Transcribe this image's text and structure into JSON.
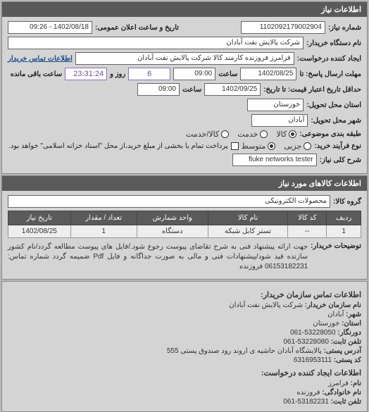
{
  "panel1": {
    "title": "اطلاعات نیاز",
    "request_no_label": "شماره نیاز:",
    "request_no": "1102092179002904",
    "public_datetime_label": "تاریخ و ساعت اعلان عمومی:",
    "public_datetime": "1402/08/18 - 09:26",
    "buyer_org_label": "نام دستگاه خریدار:",
    "buyer_org": "شرکت پالایش نفت آبادان",
    "requester_label": "ایجاد کننده درخواست:",
    "requester": "فرامرز فروزنده کارمند کالا شرکت پالایش نفت آبادان",
    "contact_link": "اطلاعات تماس خریدار",
    "deadline_label": "مهلت ارسال پاسخ: تا",
    "deadline_date": "1402/08/25",
    "time_label1": "ساعت",
    "deadline_time": "09:00",
    "and_label": "و",
    "days_remaining": "6",
    "days_label": "روز و",
    "time_remaining": "23:31:24",
    "remaining_label": "ساعت باقی مانده",
    "validity_label": "حداقل تاریخ اعتبار قیمت: تا تاریخ:",
    "validity_date": "1402/09/25",
    "time_label2": "ساعت",
    "validity_time": "09:00",
    "province_label": "استان محل تحویل:",
    "province": "خوزستان",
    "city_label": "شهر محل تحویل:",
    "city": "آبادان",
    "category_label": "طبقه بندی موضوعی:",
    "cat_goods": "کالا",
    "cat_service": "خدمت",
    "cat_goods_service": "کالا/خدمت",
    "process_label": "نوع فرآیند خرید:",
    "proc_small": "جزیی",
    "proc_medium": "متوسط",
    "payment_note": "پرداخت تمام یا بخشی از مبلغ خرید،از محل \"اسناد خزانه اسلامی\" خواهد بود.",
    "keyword_label": "شرح کلی نیاز:",
    "keyword": "fluke networks tester"
  },
  "panel2": {
    "title": "اطلاعات کالاهای مورد نیاز",
    "group_label": "گروه کالا:",
    "group": "محصولات الکترونیکی",
    "headers": {
      "row": "ردیف",
      "code": "کد کالا",
      "name": "نام کالا",
      "unit": "واحد شمارش",
      "qty": "تعداد / مقدار",
      "date": "تاریخ نیاز"
    },
    "rows": [
      {
        "row": "1",
        "code": "--",
        "name": "تستر کابل شبکه",
        "unit": "دستگاه",
        "qty": "1",
        "date": "1402/08/25"
      }
    ],
    "desc_label": "توضیحات خریدار:",
    "desc": "جهت ارائه پیشنهاد فنی به شرح تقاضای پیوست رجوع شود./فایل های پیوست مطالعه گردد/نام کشور سازنده قید شود/پیشنهادات فنی و مالی به صورت جداگانه و فایل Pdf ضمیمه گردد شماره تماس: 06153182231 فروزنده"
  },
  "panel3": {
    "section_title": "اطلاعات تماس سازمان خریدار:",
    "org_label": "نام سازمان خریدار:",
    "org": "شرکت پالایش نفت آبادان",
    "city_label": "شهر:",
    "city": "آبادان",
    "province_label": "استان:",
    "province": "خوزستان",
    "fax_label": "دورنگار:",
    "fax": "53228050-061",
    "phone_label": "تلفن ثابت:",
    "phone": "53228080-061",
    "address_label": "آدرس پستی:",
    "address": "پالایشگاه آبادان حاشیه ی اروند رود صندوق پستی 555",
    "postal_label": "کد پستی:",
    "postal": "6316953111",
    "requester_title": "اطلاعات ایجاد کننده درخواست:",
    "name_label": "نام:",
    "name": "فرامرز",
    "lastname_label": "نام خانوادگی:",
    "lastname": "فروزنده",
    "phone2_label": "تلفن ثابت:",
    "phone2": "53182231-061"
  }
}
